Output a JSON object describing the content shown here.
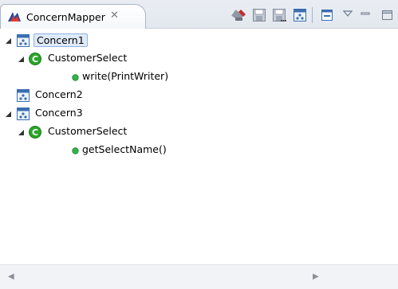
{
  "view": {
    "title": "ConcernMapper",
    "close_glyph": "✕"
  },
  "toolbar": {
    "icons": [
      "concern-manager-icon",
      "save-icon",
      "save-as-icon",
      "concern-settings-icon",
      "collapse-all-icon",
      "view-menu-icon",
      "minimize-icon"
    ]
  },
  "tree": {
    "nodes": [
      {
        "label": "Concern1",
        "kind": "concern",
        "depth": 0,
        "expanded": true,
        "selected": true
      },
      {
        "label": "CustomerSelect",
        "kind": "class",
        "depth": 1,
        "expanded": true
      },
      {
        "label": "write(PrintWriter)",
        "kind": "method",
        "depth": 2
      },
      {
        "label": "Concern2",
        "kind": "concern",
        "depth": 0
      },
      {
        "label": "Concern3",
        "kind": "concern",
        "depth": 0,
        "expanded": true
      },
      {
        "label": "CustomerSelect",
        "kind": "class",
        "depth": 1,
        "expanded": true
      },
      {
        "label": "getSelectName()",
        "kind": "method",
        "depth": 2
      }
    ]
  },
  "colors": {
    "class_icon": "#2aa52a",
    "method_icon": "#33b24a",
    "concern_icon": "#3a6fb0",
    "selection": "#dfeaf8"
  }
}
